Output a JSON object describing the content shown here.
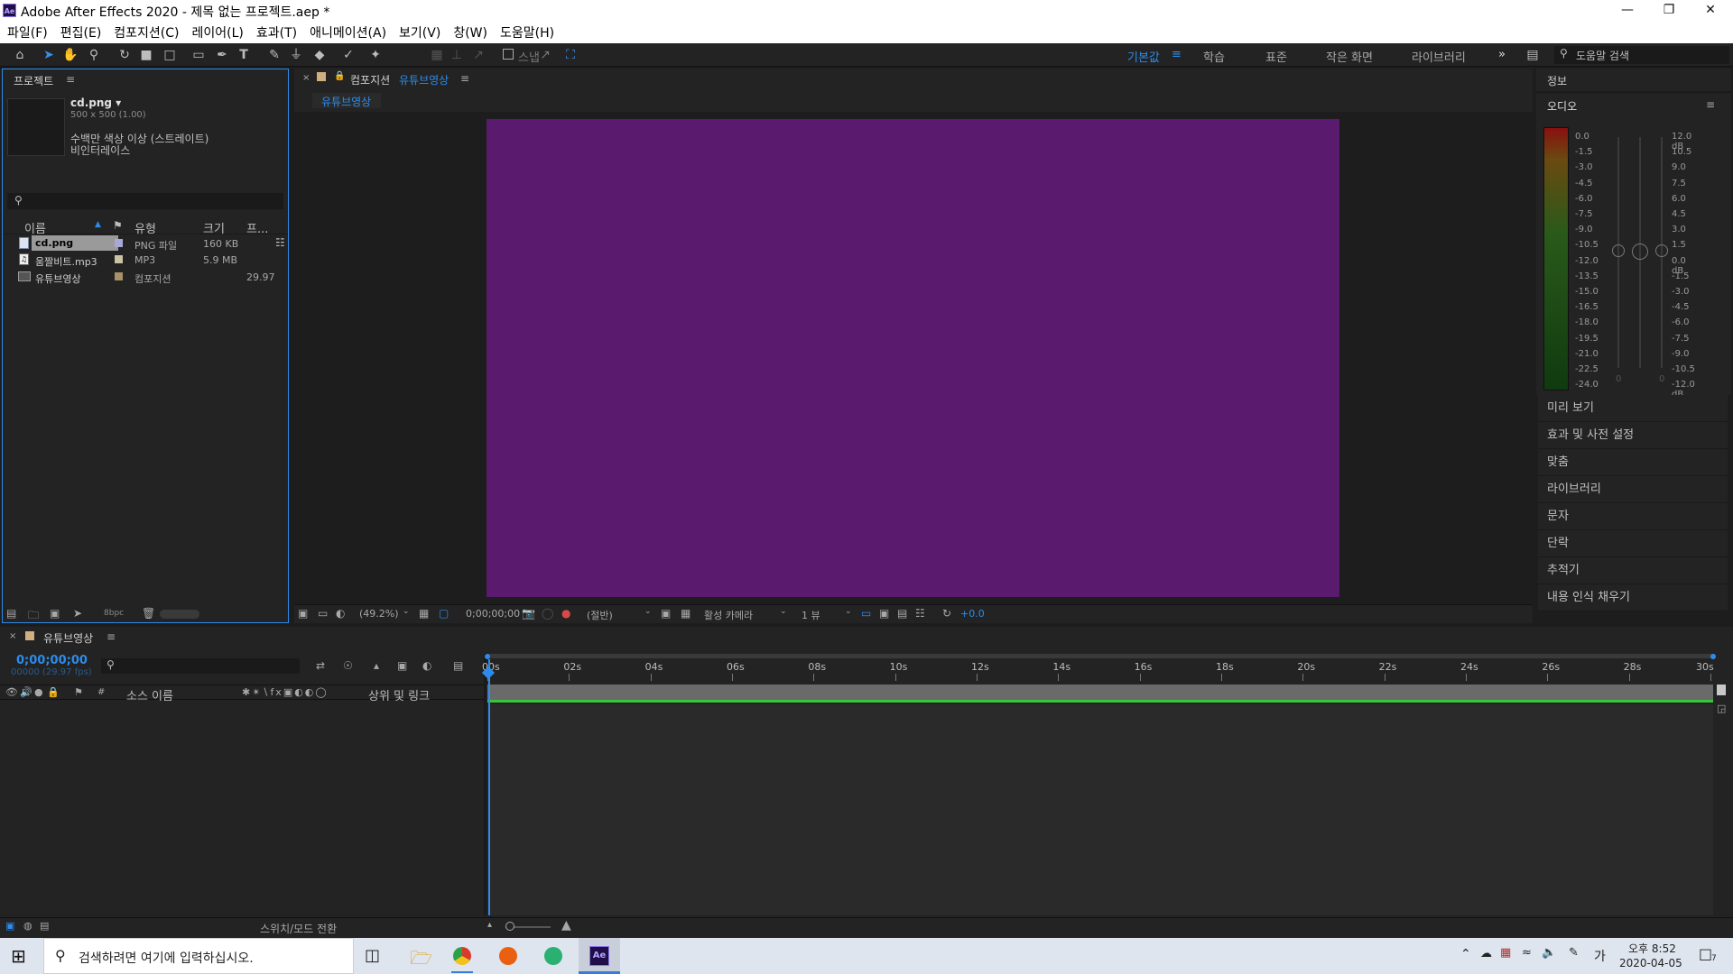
{
  "window": {
    "app_icon": "Ae",
    "title": "Adobe After Effects 2020 - 제목 없는 프로젝트.aep *",
    "controls": [
      "minimize-icon",
      "restore-icon",
      "close-icon"
    ]
  },
  "menu": [
    "파일(F)",
    "편집(E)",
    "컴포지션(C)",
    "레이어(L)",
    "효과(T)",
    "애니메이션(A)",
    "보기(V)",
    "창(W)",
    "도움말(H)"
  ],
  "toolbar": {
    "snap_label": "스냅",
    "workspaces": [
      "기본값",
      "학습",
      "표준",
      "작은 화면",
      "라이브러리"
    ],
    "active_workspace": "기본값",
    "search_placeholder": "도움말 검색"
  },
  "project": {
    "tab": "프로젝트",
    "preview": {
      "name": "cd.png ▾",
      "dims": "500 x 500 (1.00)",
      "line1": "수백만 색상 이상 (스트레이트)",
      "line2": "비인터레이스"
    },
    "search_icon": "search-icon",
    "columns": [
      "이름",
      "유형",
      "크기",
      "프..."
    ],
    "items": [
      {
        "name": "cd.png",
        "type": "PNG 파일",
        "size": "160 KB",
        "fps": "",
        "label_color": "#a8a8d8"
      },
      {
        "name": "움짤비트.mp3",
        "type": "MP3",
        "size": "5.9 MB",
        "fps": "",
        "label_color": "#c8c4a4"
      },
      {
        "name": "유튜브영상",
        "type": "컴포지션",
        "size": "",
        "fps": "29.97",
        "label_color": "#a89068"
      }
    ],
    "bpc": "8bpc"
  },
  "composition": {
    "tab_prefix": "컴포지션",
    "tab_name": "유튜브영상",
    "sub_tab": "유튜브영상",
    "canvas_color": "#5a1a6e",
    "zoom": "(49.2%)",
    "timecode": "0;00;00;00",
    "resolution": "(절반)",
    "camera": "활성 카메라",
    "views": "1 뷰",
    "exposure": "+0.0"
  },
  "right_panels": {
    "info": "정보",
    "audio": "오디오",
    "db_left": [
      "0.0",
      "-1.5",
      "-3.0",
      "-4.5",
      "-6.0",
      "-7.5",
      "-9.0",
      "-10.5",
      "-12.0",
      "-13.5",
      "-15.0",
      "-16.5",
      "-18.0",
      "-19.5",
      "-21.0",
      "-22.5",
      "-24.0"
    ],
    "db_right": [
      "12.0 dB",
      "10.5",
      "9.0",
      "7.5",
      "6.0",
      "4.5",
      "3.0",
      "1.5",
      "0.0 dB",
      "-1.5",
      "-3.0",
      "-4.5",
      "-6.0",
      "-7.5",
      "-9.0",
      "-10.5",
      "-12.0 dB"
    ],
    "slider_zero": "0",
    "items": [
      "미리 보기",
      "효과 및 사전 설정",
      "맞춤",
      "라이브러리",
      "문자",
      "단락",
      "추적기",
      "내용 인식 채우기"
    ]
  },
  "timeline": {
    "tab": "유튜브영상",
    "timecode": "0;00;00;00",
    "frames": "00000 (29.97 fps)",
    "columns": {
      "source": "소스 이름",
      "parent": "상위 및 링크"
    },
    "ruler": [
      "00s",
      "02s",
      "04s",
      "06s",
      "08s",
      "10s",
      "12s",
      "14s",
      "16s",
      "18s",
      "20s",
      "22s",
      "24s",
      "26s",
      "28s",
      "30s"
    ],
    "toggle_label": "스위치/모드 전환"
  },
  "taskbar": {
    "search_placeholder": "검색하려면 여기에 입력하십시오.",
    "apps": [
      "task-view-icon",
      "file-explorer-icon",
      "chrome-icon",
      "app-orange-icon",
      "app-green-icon",
      "after-effects-icon"
    ],
    "ime": "가",
    "time": "오후 8:52",
    "date": "2020-04-05",
    "notifications": "7"
  }
}
